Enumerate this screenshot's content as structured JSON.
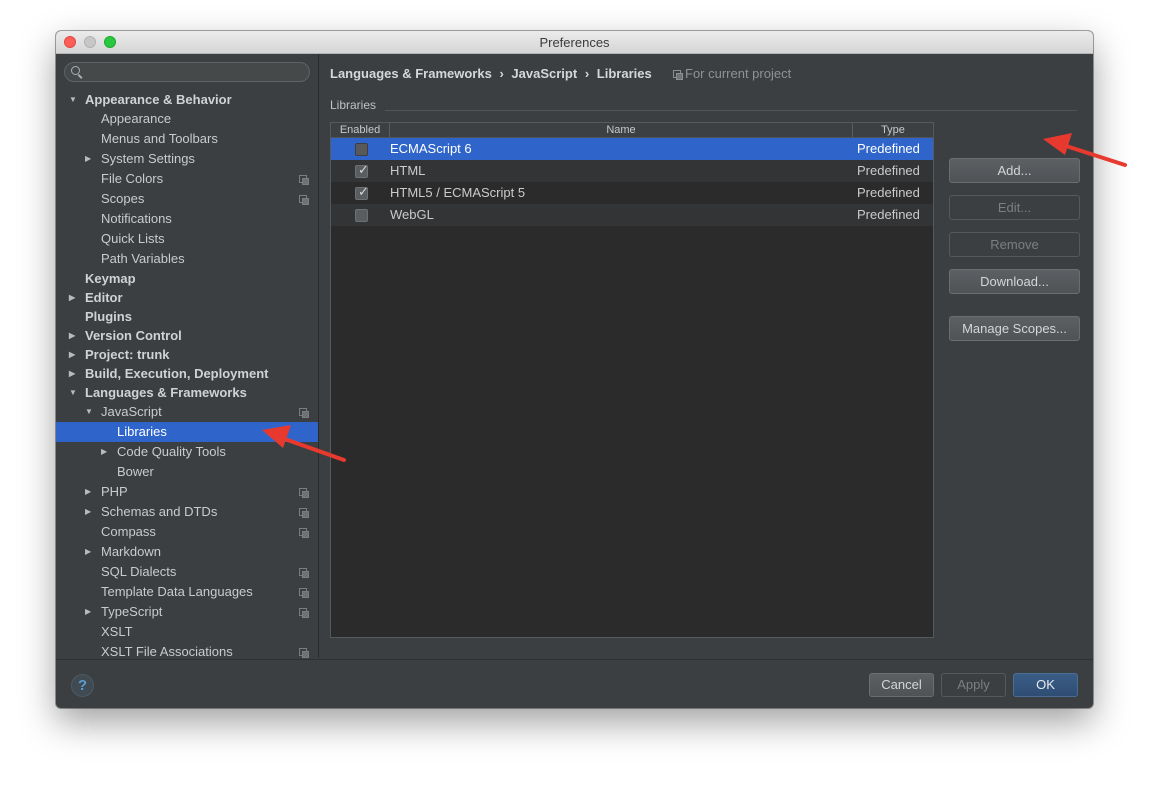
{
  "window": {
    "title": "Preferences"
  },
  "search": {
    "placeholder": ""
  },
  "tree": [
    {
      "label": "Appearance & Behavior",
      "level": 0,
      "group": true,
      "arrow": "expanded"
    },
    {
      "label": "Appearance",
      "level": 1
    },
    {
      "label": "Menus and Toolbars",
      "level": 1
    },
    {
      "label": "System Settings",
      "level": 1,
      "arrow": "collapsed"
    },
    {
      "label": "File Colors",
      "level": 1,
      "project": true
    },
    {
      "label": "Scopes",
      "level": 1,
      "project": true
    },
    {
      "label": "Notifications",
      "level": 1
    },
    {
      "label": "Quick Lists",
      "level": 1
    },
    {
      "label": "Path Variables",
      "level": 1
    },
    {
      "label": "Keymap",
      "level": 0,
      "group": true
    },
    {
      "label": "Editor",
      "level": 0,
      "group": true,
      "arrow": "collapsed"
    },
    {
      "label": "Plugins",
      "level": 0,
      "group": true
    },
    {
      "label": "Version Control",
      "level": 0,
      "group": true,
      "arrow": "collapsed"
    },
    {
      "label": "Project: trunk",
      "level": 0,
      "group": true,
      "arrow": "collapsed"
    },
    {
      "label": "Build, Execution, Deployment",
      "level": 0,
      "group": true,
      "arrow": "collapsed"
    },
    {
      "label": "Languages & Frameworks",
      "level": 0,
      "group": true,
      "arrow": "expanded"
    },
    {
      "label": "JavaScript",
      "level": 1,
      "arrow": "expanded",
      "project": true
    },
    {
      "label": "Libraries",
      "level": 2,
      "selected": true
    },
    {
      "label": "Code Quality Tools",
      "level": 2,
      "arrow": "collapsed"
    },
    {
      "label": "Bower",
      "level": 2
    },
    {
      "label": "PHP",
      "level": 1,
      "arrow": "collapsed",
      "project": true
    },
    {
      "label": "Schemas and DTDs",
      "level": 1,
      "arrow": "collapsed",
      "project": true
    },
    {
      "label": "Compass",
      "level": 1,
      "project": true
    },
    {
      "label": "Markdown",
      "level": 1,
      "arrow": "collapsed"
    },
    {
      "label": "SQL Dialects",
      "level": 1,
      "project": true
    },
    {
      "label": "Template Data Languages",
      "level": 1,
      "project": true
    },
    {
      "label": "TypeScript",
      "level": 1,
      "arrow": "collapsed",
      "project": true
    },
    {
      "label": "XSLT",
      "level": 1
    },
    {
      "label": "XSLT File Associations",
      "level": 1,
      "project": true
    }
  ],
  "breadcrumb": {
    "parts": [
      "Languages & Frameworks",
      "›",
      "JavaScript",
      "›",
      "Libraries"
    ],
    "note": "For current project"
  },
  "section": {
    "title": "Libraries"
  },
  "table": {
    "columns": [
      "Enabled",
      "Name",
      "Type"
    ],
    "rows": [
      {
        "enabled": false,
        "name": "ECMAScript 6",
        "type": "Predefined",
        "selected": true
      },
      {
        "enabled": true,
        "name": "HTML",
        "type": "Predefined"
      },
      {
        "enabled": true,
        "name": "HTML5 / ECMAScript 5",
        "type": "Predefined"
      },
      {
        "enabled": false,
        "name": "WebGL",
        "type": "Predefined"
      }
    ]
  },
  "actions": {
    "add": "Add...",
    "edit": "Edit...",
    "remove": "Remove",
    "download": "Download...",
    "manage_scopes": "Manage Scopes..."
  },
  "footer": {
    "help": "?",
    "cancel": "Cancel",
    "apply": "Apply",
    "ok": "OK"
  },
  "colors": {
    "selection": "#2f65ca",
    "annotation_arrow": "#e8392f",
    "background": "#3c3f41"
  }
}
